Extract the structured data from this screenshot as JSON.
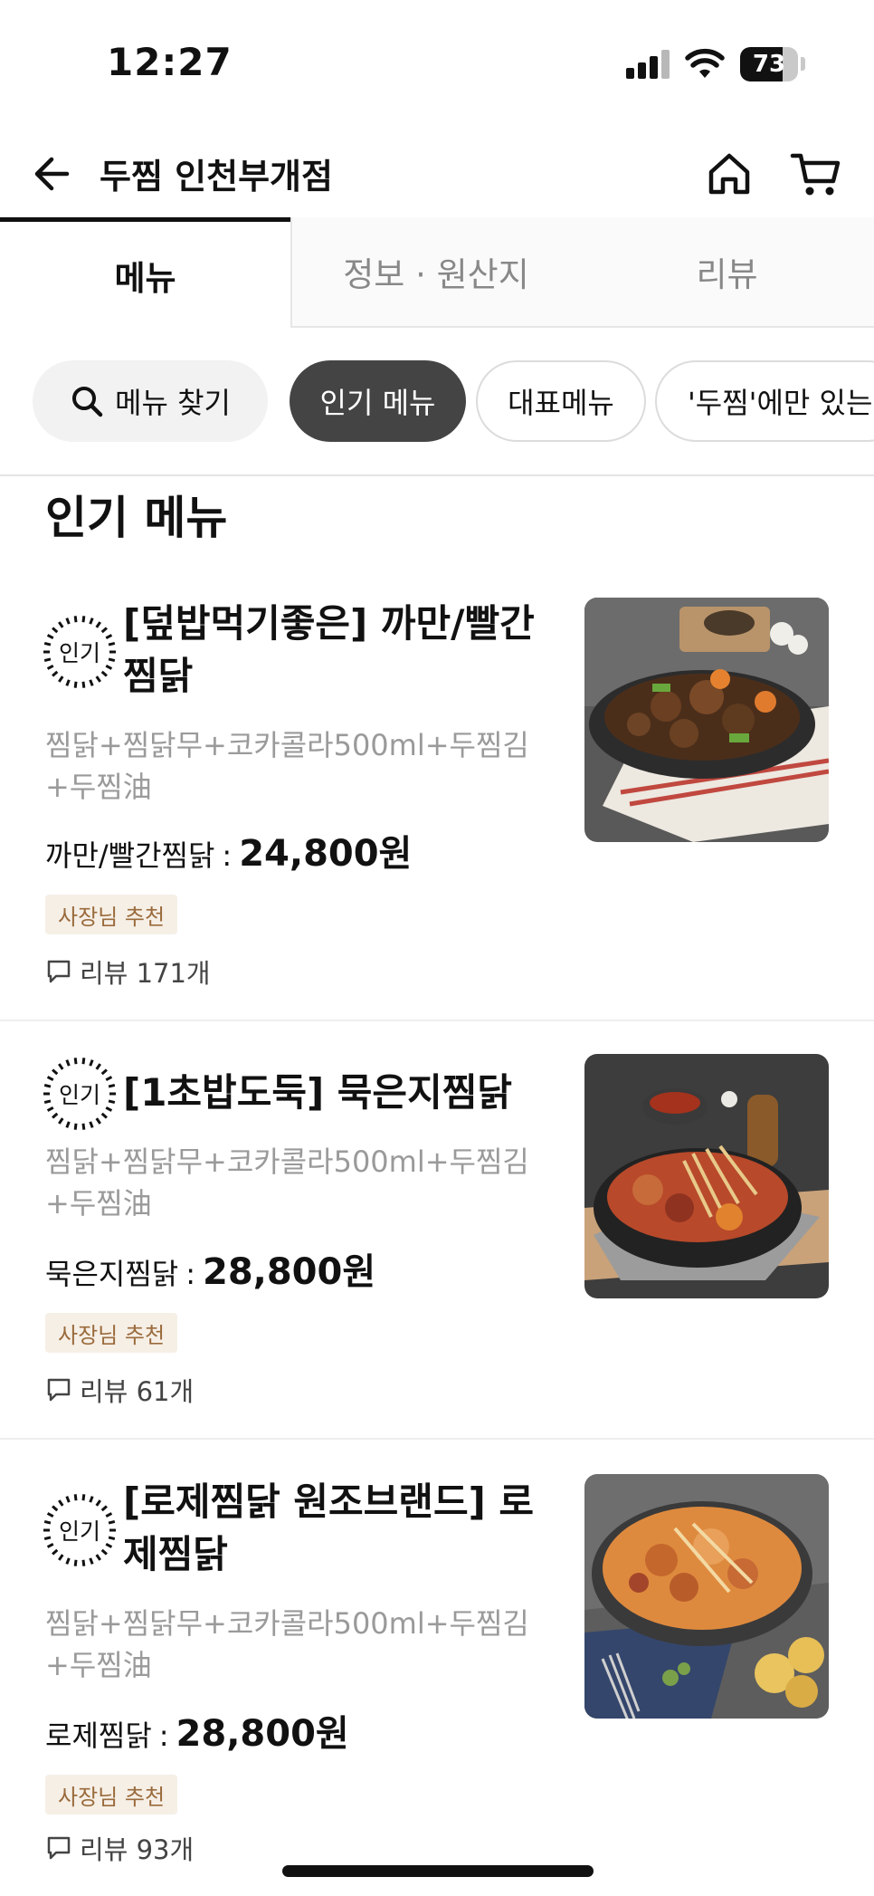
{
  "status_bar": {
    "time": "12:27",
    "battery_level": 73,
    "battery_label": "73"
  },
  "header": {
    "store_name": "두찜 인천부개점"
  },
  "tabs": [
    {
      "label": "메뉴",
      "active": true
    },
    {
      "label": "정보 · 원산지",
      "active": false
    },
    {
      "label": "리뷰",
      "active": false
    }
  ],
  "filter_chips": {
    "search": "메뉴 찾기",
    "popular": "인기 메뉴",
    "representative": "대표메뉴",
    "only_here": "'두찜'에만 있는 메뉴"
  },
  "section_title": "인기 메뉴",
  "items": [
    {
      "badge": "인기",
      "name": "[덮밥먹기좋은] 까만/빨간찜닭",
      "description": "찜닭+찜닭무+코카콜라500ml+두찜김+두찜油",
      "price_label": "까만/빨간찜닭",
      "price": "24,800원",
      "tag": "사장님 추천",
      "review": "리뷰 171개"
    },
    {
      "badge": "인기",
      "name": "[1초밥도둑] 묵은지찜닭",
      "description": "찜닭+찜닭무+코카콜라500ml+두찜김+두찜油",
      "price_label": "묵은지찜닭",
      "price": "28,800원",
      "tag": "사장님 추천",
      "review": "리뷰 61개"
    },
    {
      "badge": "인기",
      "name": "[로제찜닭 원조브랜드] 로제찜닭",
      "description": "찜닭+찜닭무+코카콜라500ml+두찜김+두찜油",
      "price_label": "로제찜닭",
      "price": "28,800원",
      "tag": "사장님 추천",
      "review": "리뷰 93개"
    }
  ],
  "colors": {
    "active_chip_bg": "#444444",
    "tag_bg": "#f6efe6",
    "tag_text": "#9a6b3c",
    "description_text": "#9a9a9a"
  },
  "icons": [
    "back-arrow-icon",
    "home-icon",
    "cart-icon",
    "search-icon",
    "popular-badge-icon",
    "review-bubble-icon",
    "signal-icon",
    "wifi-icon",
    "battery-icon"
  ]
}
